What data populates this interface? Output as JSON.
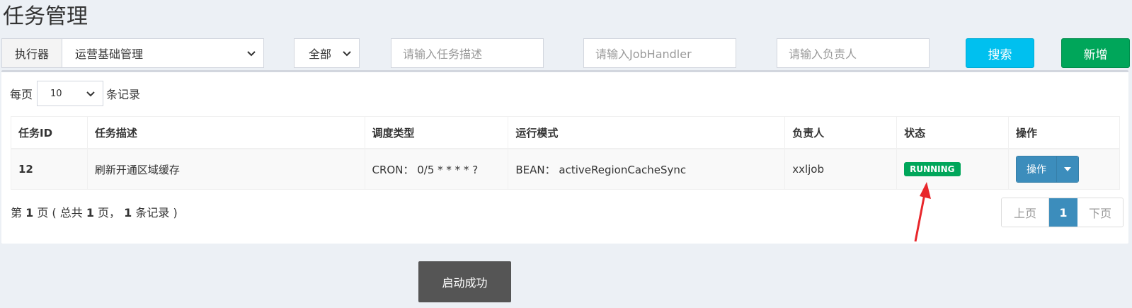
{
  "page_title": "任务管理",
  "filters": {
    "executor_label": "执行器",
    "executor_value": "运营基础管理",
    "status_value": "全部",
    "desc_placeholder": "请输入任务描述",
    "handler_placeholder": "请输入JobHandler",
    "author_placeholder": "请输入负责人",
    "search_label": "搜索",
    "add_label": "新增"
  },
  "perpage": {
    "prefix": "每页",
    "value": "10",
    "suffix": "条记录"
  },
  "table": {
    "headers": [
      "任务ID",
      "任务描述",
      "调度类型",
      "运行模式",
      "负责人",
      "状态",
      "操作"
    ],
    "rows": [
      {
        "id": "12",
        "desc": "刷新开通区域缓存",
        "schedule": "CRON：  0/5 * * * * ?",
        "mode": "BEAN：  activeRegionCacheSync",
        "author": "xxljob",
        "status": "RUNNING",
        "action": "操作"
      }
    ]
  },
  "info": {
    "p1": "第 ",
    "page": "1",
    "p2": " 页 ( 总共 ",
    "total_pages": "1",
    "p3": " 页，  ",
    "records": "1",
    "p4": " 条记录 )"
  },
  "pagination": {
    "prev": "上页",
    "current": "1",
    "next": "下页"
  },
  "toast": "启动成功",
  "colors": {
    "info": "#00c0ef",
    "success": "#00a65a",
    "primary": "#3c8dbc",
    "annotation": "#e8262b"
  },
  "icons": [
    "chevron-down-icon",
    "caret-down-icon",
    "red-arrow-annotation"
  ]
}
